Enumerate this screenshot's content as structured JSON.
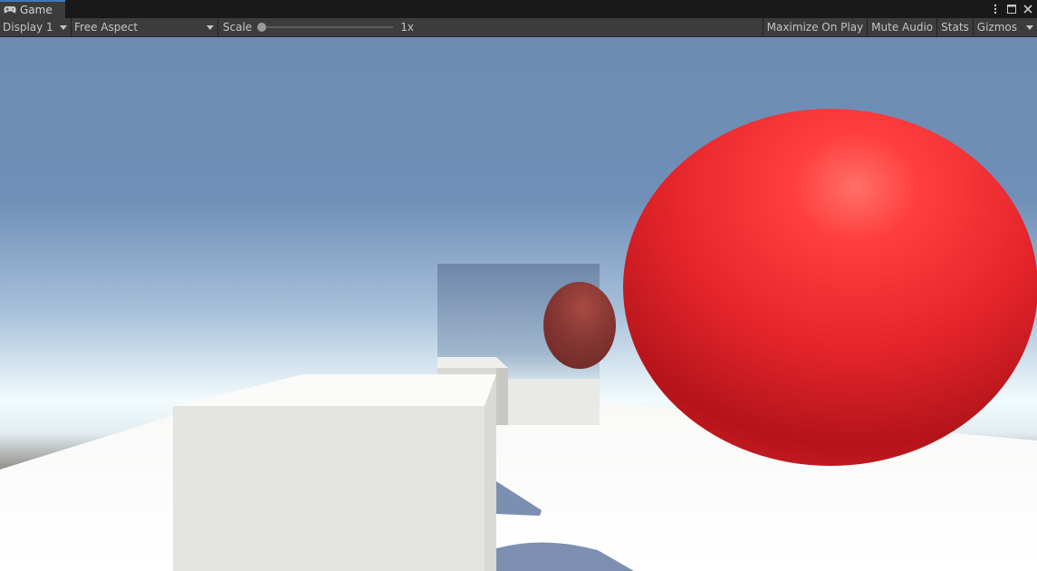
{
  "tabs": [
    {
      "label": "Game",
      "icon": "gamepad-icon",
      "active": true
    }
  ],
  "tab_actions": {
    "more_icon": "more-vertical-icon",
    "maximize_icon": "maximize-icon",
    "close_icon": "close-icon"
  },
  "toolbar": {
    "display": {
      "value": "Display 1"
    },
    "aspect": {
      "value": "Free Aspect"
    },
    "scale": {
      "label": "Scale",
      "value": "1x",
      "level": 0
    },
    "maximize_on_play": "Maximize On Play",
    "mute_audio": "Mute Audio",
    "stats": "Stats",
    "gizmos": "Gizmos"
  },
  "colors": {
    "accent": "#3a79bb",
    "sphere": "#e8262c",
    "ground": "#f5f5f3",
    "cube": "#e3e3df"
  }
}
